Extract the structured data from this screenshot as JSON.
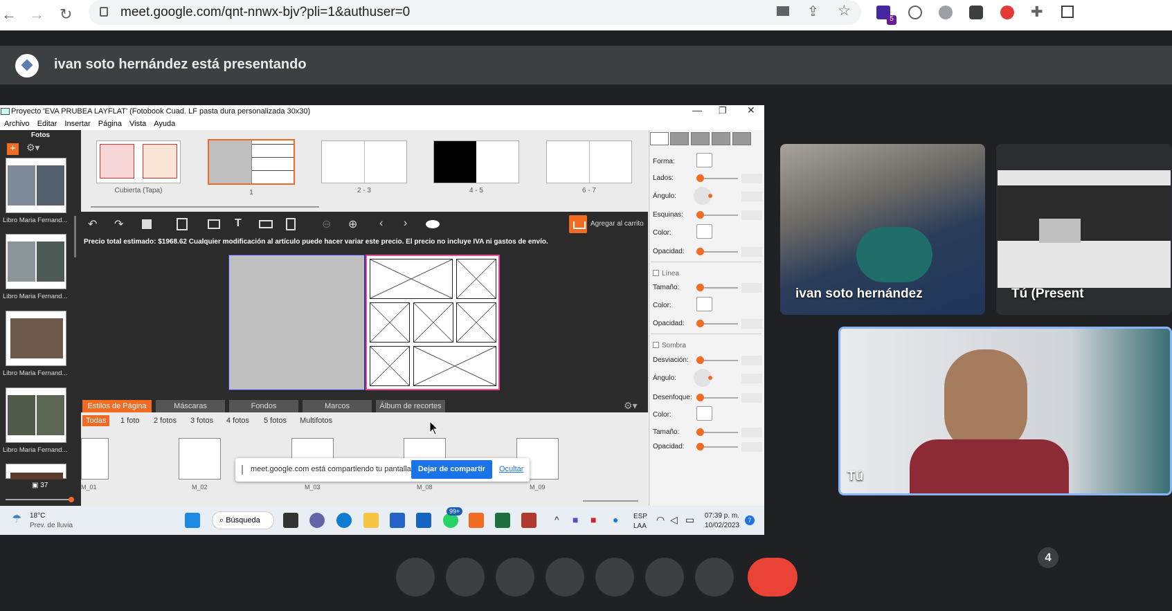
{
  "browser": {
    "url": "meet.google.com/qnt-nnwx-bjv?pli=1&authuser=0",
    "ext_badge": "5"
  },
  "meet": {
    "presenting_banner": "ivan soto hernández está presentando",
    "participants": [
      {
        "name": "ivan soto hernández"
      },
      {
        "name": "Tú (Present"
      },
      {
        "name": "Tú"
      }
    ],
    "people_count": "4"
  },
  "app": {
    "window_title": "Proyecto 'EVA PRUBEA LAYFLAT' (Fotobook Cuad. LF pasta dura personalizada 30x30)",
    "menu": [
      "Archivo",
      "Editar",
      "Insertar",
      "Página",
      "Vista",
      "Ayuda"
    ],
    "sidebar": {
      "header": "Fotos",
      "photos": [
        {
          "label": "Libro Maria Fernand..."
        },
        {
          "label": "Libro Maria Fernand..."
        },
        {
          "label": "Libro Maria Fernand..."
        },
        {
          "label": "Libro Maria Fernand..."
        }
      ],
      "count": "37"
    },
    "spreads": [
      {
        "label": "Cubierta (Tapa)"
      },
      {
        "label": "1"
      },
      {
        "label": "2 - 3"
      },
      {
        "label": "4 - 5"
      },
      {
        "label": "6 - 7"
      }
    ],
    "cart_label": "Agregar al carrito",
    "price_text": "Precio total estimado: $1968.62    Cualquier modificación al artículo puede hacer variar este precio. El precio no incluye IVA ni gastos de envío.",
    "bottom_tabs": [
      "Estilos de Página",
      "Máscaras",
      "Fondos",
      "Marcos",
      "Álbum de recortes"
    ],
    "filters": [
      "Todas",
      "1 foto",
      "2 fotos",
      "3 fotos",
      "4 fotos",
      "5 fotos",
      "Multifotos"
    ],
    "layouts": [
      "M_01",
      "M_02",
      "M_03",
      "M_08",
      "M_09"
    ],
    "share_toast": {
      "message": "meet.google.com está compartiendo tu pantalla.",
      "stop_button": "Dejar de compartir",
      "hide_link": "Ocultar"
    },
    "properties": {
      "forma": "Forma:",
      "lados": "Lados:",
      "angulo": "Ángulo:",
      "esquinas": "Esquinas:",
      "color": "Color:",
      "opacidad": "Opacidad:",
      "linea": "Línea",
      "tamano": "Tamaño:",
      "sombra": "Sombra",
      "desviacion": "Desviación:",
      "desenfoque": "Desenfoque:"
    },
    "taskbar": {
      "weather_temp": "18°C",
      "weather_desc": "Prev. de lluvia",
      "search": "Búsqueda",
      "mail_badge": "99+",
      "lang1": "ESP",
      "lang2": "LAA",
      "time": "07:39 p. m.",
      "date": "10/02/2023",
      "notif": "7"
    }
  },
  "colors": {
    "accent": "#f26b22",
    "meet_bg": "#202124",
    "button_blue": "#1a73e8"
  }
}
